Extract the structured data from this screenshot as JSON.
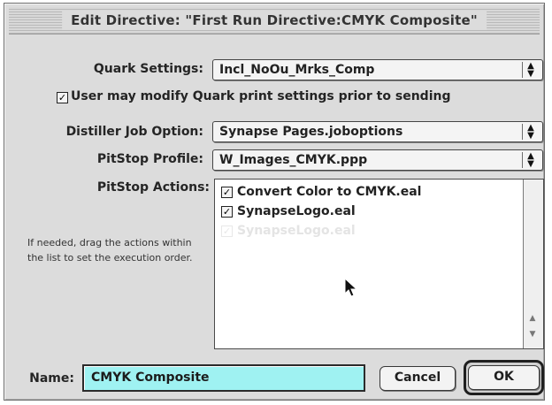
{
  "window": {
    "title": "Edit Directive: \"First Run Directive:CMYK Composite\""
  },
  "quark_settings": {
    "label": "Quark Settings:",
    "value": "Incl_NoOu_Mrks_Comp"
  },
  "modify_checkbox": {
    "checked": true,
    "label": "User may modify Quark print settings prior to sending"
  },
  "distiller": {
    "label": "Distiller Job Option:",
    "value": "Synapse Pages.joboptions"
  },
  "pitstop_profile": {
    "label": "PitStop Profile:",
    "value": "W_Images_CMYK.ppp"
  },
  "pitstop_actions": {
    "label": "PitStop Actions:",
    "items": [
      {
        "label": "Convert Color to CMYK.eal",
        "checked": true
      },
      {
        "label": "SynapseLogo.eal",
        "checked": true
      },
      {
        "label": "SynapseLogo.eal",
        "checked": true
      }
    ]
  },
  "hint": {
    "text": "If needed, drag the actions within the list to set the execution order."
  },
  "name": {
    "label": "Name:",
    "value": "CMYK Composite"
  },
  "buttons": {
    "cancel": "Cancel",
    "ok": "OK"
  },
  "colors": {
    "window_bg": "#dcdcdc",
    "name_field_bg": "#9ff2f2",
    "text": "#222222"
  },
  "icons": {
    "popup_arrow": "up-down-arrows-icon",
    "checkbox": "checkmark-icon",
    "cursor": "arrow-cursor-icon"
  }
}
